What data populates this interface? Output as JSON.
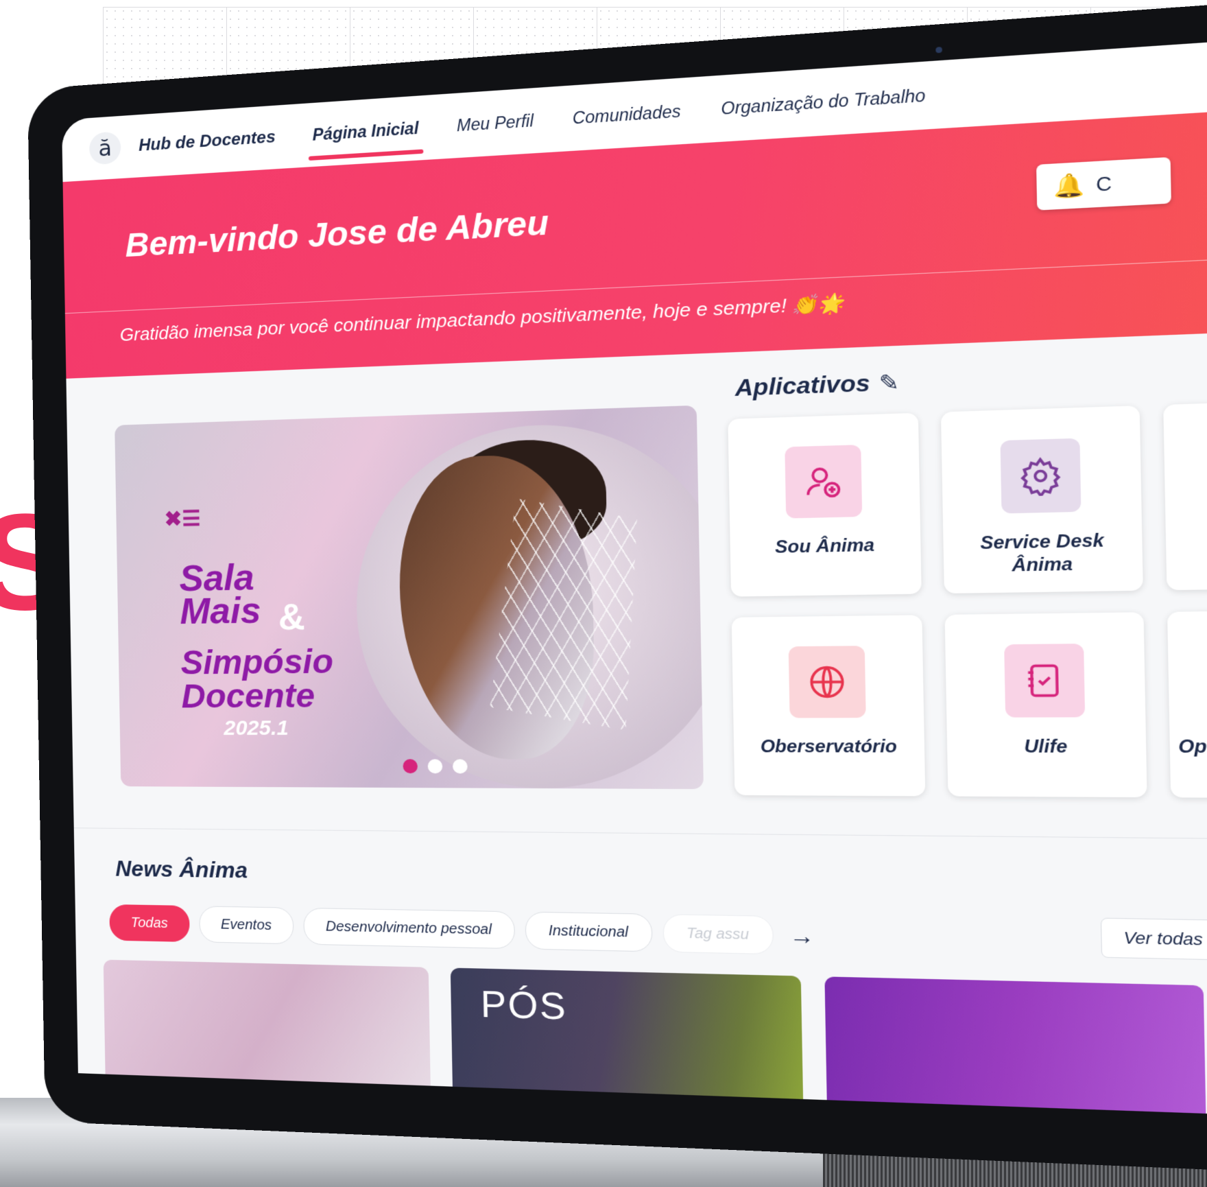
{
  "nav": {
    "logo": "ă",
    "brand": "Hub de Docentes",
    "links": [
      "Página Inicial",
      "Meu Perfil",
      "Comunidades",
      "Organização do Trabalho"
    ],
    "active_index": 0,
    "notif_text": "C"
  },
  "hero": {
    "title": "Bem-vindo Jose de Abreu",
    "message": "Gratidão imensa por você continuar impactando positivamente, hoje e sempre! 👏🌟"
  },
  "banner": {
    "line1": "Sala",
    "line1b": "Mais",
    "amp": "&",
    "line2": "Simpósio",
    "line2b": "Docente",
    "year": "2025.1",
    "slides": 3,
    "active_slide": 0
  },
  "apps": {
    "title": "Aplicativos",
    "items": [
      {
        "label": "Sou Ânima",
        "icon": "user-add-icon",
        "bg": "#f9d3e6",
        "fg": "#d6247c"
      },
      {
        "label": "Service Desk Ânima",
        "icon": "gear-icon",
        "bg": "#e6dcec",
        "fg": "#7a3d98"
      },
      {
        "label": "",
        "icon": "",
        "bg": "#ffffff",
        "fg": "#ffffff"
      },
      {
        "label": "Oberservatório",
        "icon": "globe-icon",
        "bg": "#fbd6da",
        "fg": "#e8344e"
      },
      {
        "label": "Ulife",
        "icon": "checklist-icon",
        "bg": "#f9d3e6",
        "fg": "#d6247c"
      },
      {
        "label": "Opo\nI",
        "icon": "",
        "bg": "#ffffff",
        "fg": "#ffffff"
      }
    ]
  },
  "news": {
    "title": "News Ânima",
    "tags": [
      "Todas",
      "Eventos",
      "Desenvolvimento pessoal",
      "Institucional",
      "Tag assu"
    ],
    "see_all": "Ver todas",
    "card2_text": "PÓS"
  },
  "colors": {
    "accent": "#f0345e",
    "navy": "#1d2a4a"
  }
}
